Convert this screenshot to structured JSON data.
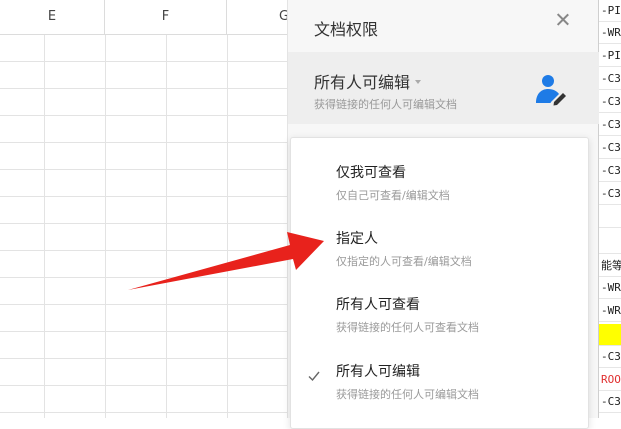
{
  "sheet": {
    "columns": [
      {
        "label": "E"
      },
      {
        "label": "F"
      },
      {
        "label": "G"
      }
    ]
  },
  "strip": {
    "cells": [
      {
        "text": "-PI",
        "style": "normal"
      },
      {
        "text": "-WR",
        "style": "normal"
      },
      {
        "text": "-PI",
        "style": "normal"
      },
      {
        "text": "-C3",
        "style": "normal"
      },
      {
        "text": "-C3",
        "style": "normal"
      },
      {
        "text": "-C3",
        "style": "normal"
      },
      {
        "text": "-C3",
        "style": "normal"
      },
      {
        "text": "-C3",
        "style": "normal"
      },
      {
        "text": "-C3",
        "style": "normal"
      },
      {
        "text": "",
        "style": "normal"
      },
      {
        "text": "",
        "style": "normal"
      },
      {
        "text": "能等",
        "style": "normal"
      },
      {
        "text": "-WR",
        "style": "normal"
      },
      {
        "text": "-WR",
        "style": "normal"
      },
      {
        "text": "",
        "style": "yellow"
      },
      {
        "text": "-C3",
        "style": "normal"
      },
      {
        "text": "ROO",
        "style": "red"
      },
      {
        "text": "-C3",
        "style": "normal"
      },
      {
        "text": "-WR",
        "style": "normal"
      }
    ]
  },
  "panel": {
    "title": "文档权限",
    "current": {
      "label": "所有人可编辑",
      "description": "获得链接的任何人可编辑文档"
    },
    "options": [
      {
        "label": "仅我可查看",
        "description": "仅自己可查看/编辑文档",
        "selected": false
      },
      {
        "label": "指定人",
        "description": "仅指定的人可查看/编辑文档",
        "selected": false
      },
      {
        "label": "所有人可查看",
        "description": "获得链接的任何人可查看文档",
        "selected": false
      },
      {
        "label": "所有人可编辑",
        "description": "获得链接的任何人可编辑文档",
        "selected": true
      }
    ]
  },
  "colors": {
    "accent_blue": "#1e7be6",
    "arrow_red": "#e8221c",
    "highlight_yellow": "#ffff00"
  }
}
